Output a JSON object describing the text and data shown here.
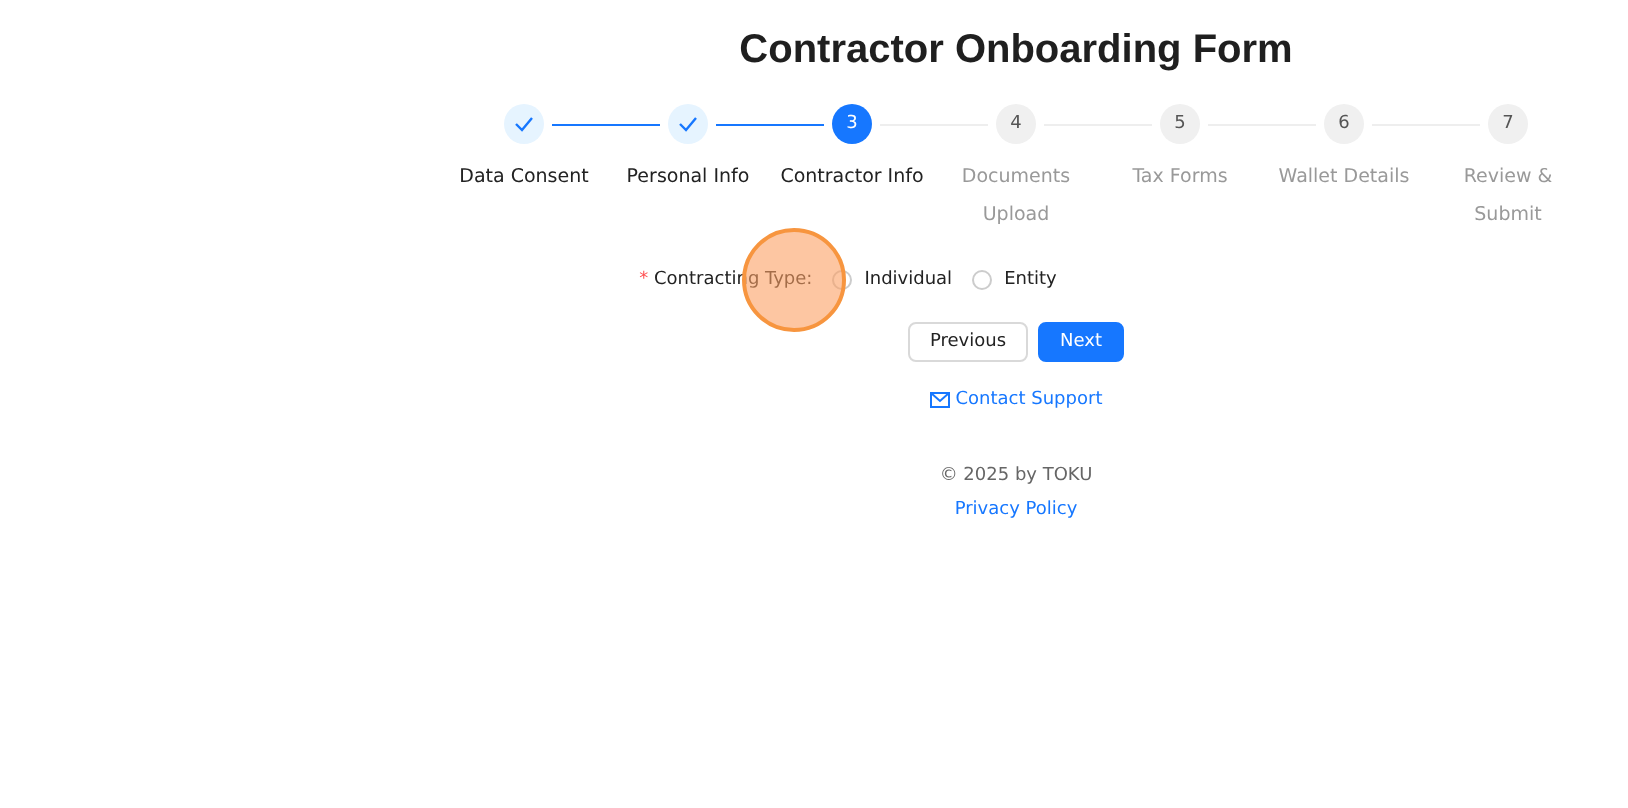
{
  "title": "Contractor Onboarding Form",
  "steps": [
    {
      "label": "Data Consent",
      "completed": true,
      "selected": false
    },
    {
      "label": "Personal Info",
      "completed": true,
      "selected": false
    },
    {
      "number": "3",
      "label": "Contractor Info",
      "completed": false,
      "selected": true
    },
    {
      "number": "4",
      "label": "Documents Upload",
      "completed": false,
      "selected": false
    },
    {
      "number": "5",
      "label": "Tax Forms",
      "completed": false,
      "selected": false
    },
    {
      "number": "6",
      "label": "Wallet Details",
      "completed": false,
      "selected": false
    },
    {
      "number": "7",
      "label": "Review & Submit",
      "completed": false,
      "selected": false
    }
  ],
  "field": {
    "required_mark": "*",
    "label": "Contracting Type:",
    "options": [
      {
        "label": "Individual",
        "selected": false
      },
      {
        "label": "Entity",
        "selected": false
      }
    ]
  },
  "buttons": [
    {
      "label": "Previous",
      "kind": "default"
    },
    {
      "label": "Next",
      "kind": "primary"
    }
  ],
  "contact_link": "Contact Support",
  "footer": {
    "copyright": "© 2025 by TOKU",
    "privacy_link": "Privacy Policy"
  },
  "click_highlight": true
}
